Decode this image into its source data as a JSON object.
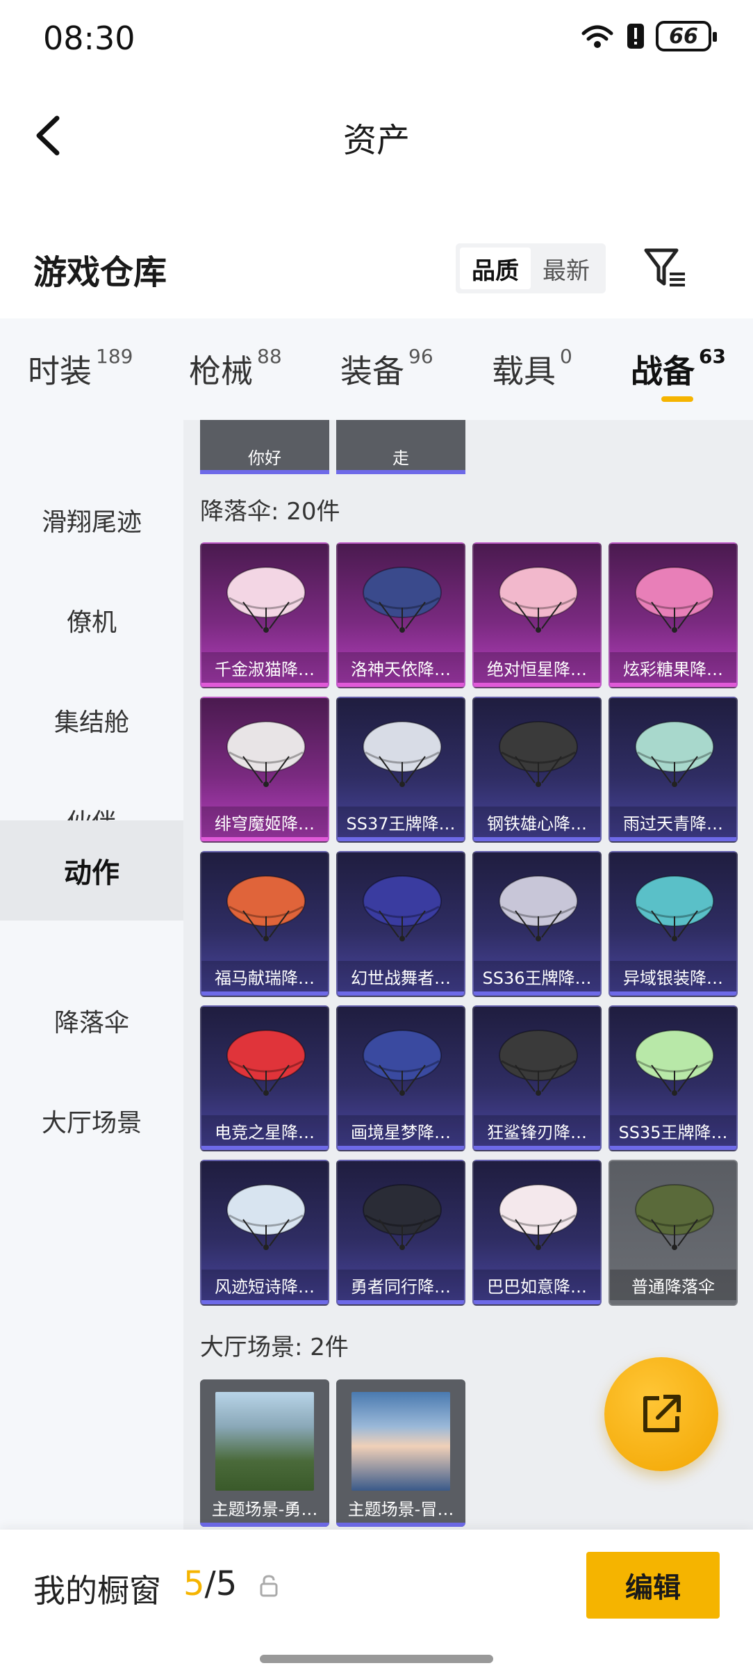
{
  "status_bar": {
    "time": "08:30",
    "battery": "66"
  },
  "nav": {
    "title": "资产"
  },
  "section": {
    "title": "游戏仓库",
    "sort_quality": "品质",
    "sort_newest": "最新"
  },
  "tabs": [
    {
      "label": "时装",
      "count": "189"
    },
    {
      "label": "枪械",
      "count": "88"
    },
    {
      "label": "装备",
      "count": "96"
    },
    {
      "label": "载具",
      "count": "0"
    },
    {
      "label": "战备",
      "count": "63"
    }
  ],
  "sidebar": {
    "items": [
      "滑翔尾迹",
      "僚机",
      "集结舱",
      "伙伴",
      "动作",
      "降落伞",
      "大厅场景"
    ]
  },
  "top_row": [
    "你好",
    "走"
  ],
  "parachutes": {
    "title": "降落伞: 20件",
    "items": [
      "千金淑猫降…",
      "洛神天依降…",
      "绝对恒星降…",
      "炫彩糖果降…",
      "绯穹魔姬降…",
      "SS37王牌降…",
      "钢铁雄心降…",
      "雨过天青降…",
      "福马献瑞降…",
      "幻世战舞者…",
      "SS36王牌降…",
      "异域银装降…",
      "电竞之星降…",
      "画境星梦降…",
      "狂鲨锋刃降…",
      "SS35王牌降…",
      "风迹短诗降…",
      "勇者同行降…",
      "巴巴如意降…",
      "普通降落伞"
    ],
    "tiers": [
      "purple",
      "purple",
      "purple",
      "purple",
      "purple",
      "blue",
      "blue",
      "blue",
      "blue",
      "blue",
      "blue",
      "blue",
      "blue",
      "blue",
      "blue",
      "blue",
      "blue",
      "blue",
      "blue",
      "gray"
    ],
    "colors": [
      "#f3d6e4",
      "#3a4a8c",
      "#f2b8cc",
      "#e87fb8",
      "#e8e4e6",
      "#d8dce6",
      "#3a3a3a",
      "#a8d8cc",
      "#e0643a",
      "#3a3ca0",
      "#c8c6d8",
      "#5ac0c8",
      "#e0343a",
      "#3a4aa0",
      "#3a3a3a",
      "#b8e8a8",
      "#d8e4f0",
      "#2a2c36",
      "#f4e8ec",
      "#5a6a3a"
    ]
  },
  "scenes": {
    "title": "大厅场景: 2件",
    "items": [
      "主题场景-勇…",
      "主题场景-冒…"
    ]
  },
  "bottom": {
    "title": "我的橱窗",
    "current": "5",
    "separator": "/",
    "total": "5",
    "edit_label": "编辑"
  }
}
